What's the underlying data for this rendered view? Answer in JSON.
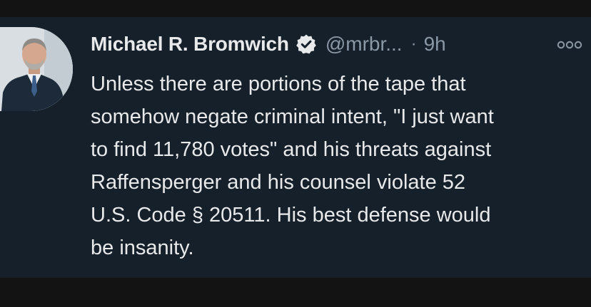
{
  "tweet": {
    "author": {
      "display_name": "Michael R. Bromwich",
      "handle": "@mrbr...",
      "verified_icon": "verified-badge-icon",
      "avatar_icon": "profile-photo"
    },
    "separator": "·",
    "timestamp": "9h",
    "more_icon": "more-options-icon",
    "text_lines": [
      "Unless there are portions of the tape that",
      "somehow negate criminal intent, \"I just want",
      "to find 11,780 votes\" and his threats against",
      "Raffensperger and his counsel violate 52",
      "U.S. Code § 20511.  His best defense would",
      "be insanity."
    ]
  },
  "colors": {
    "card_background": "#16202b",
    "page_background": "#131314",
    "primary_text": "#e7e9ea",
    "secondary_text": "#8b98a5"
  }
}
